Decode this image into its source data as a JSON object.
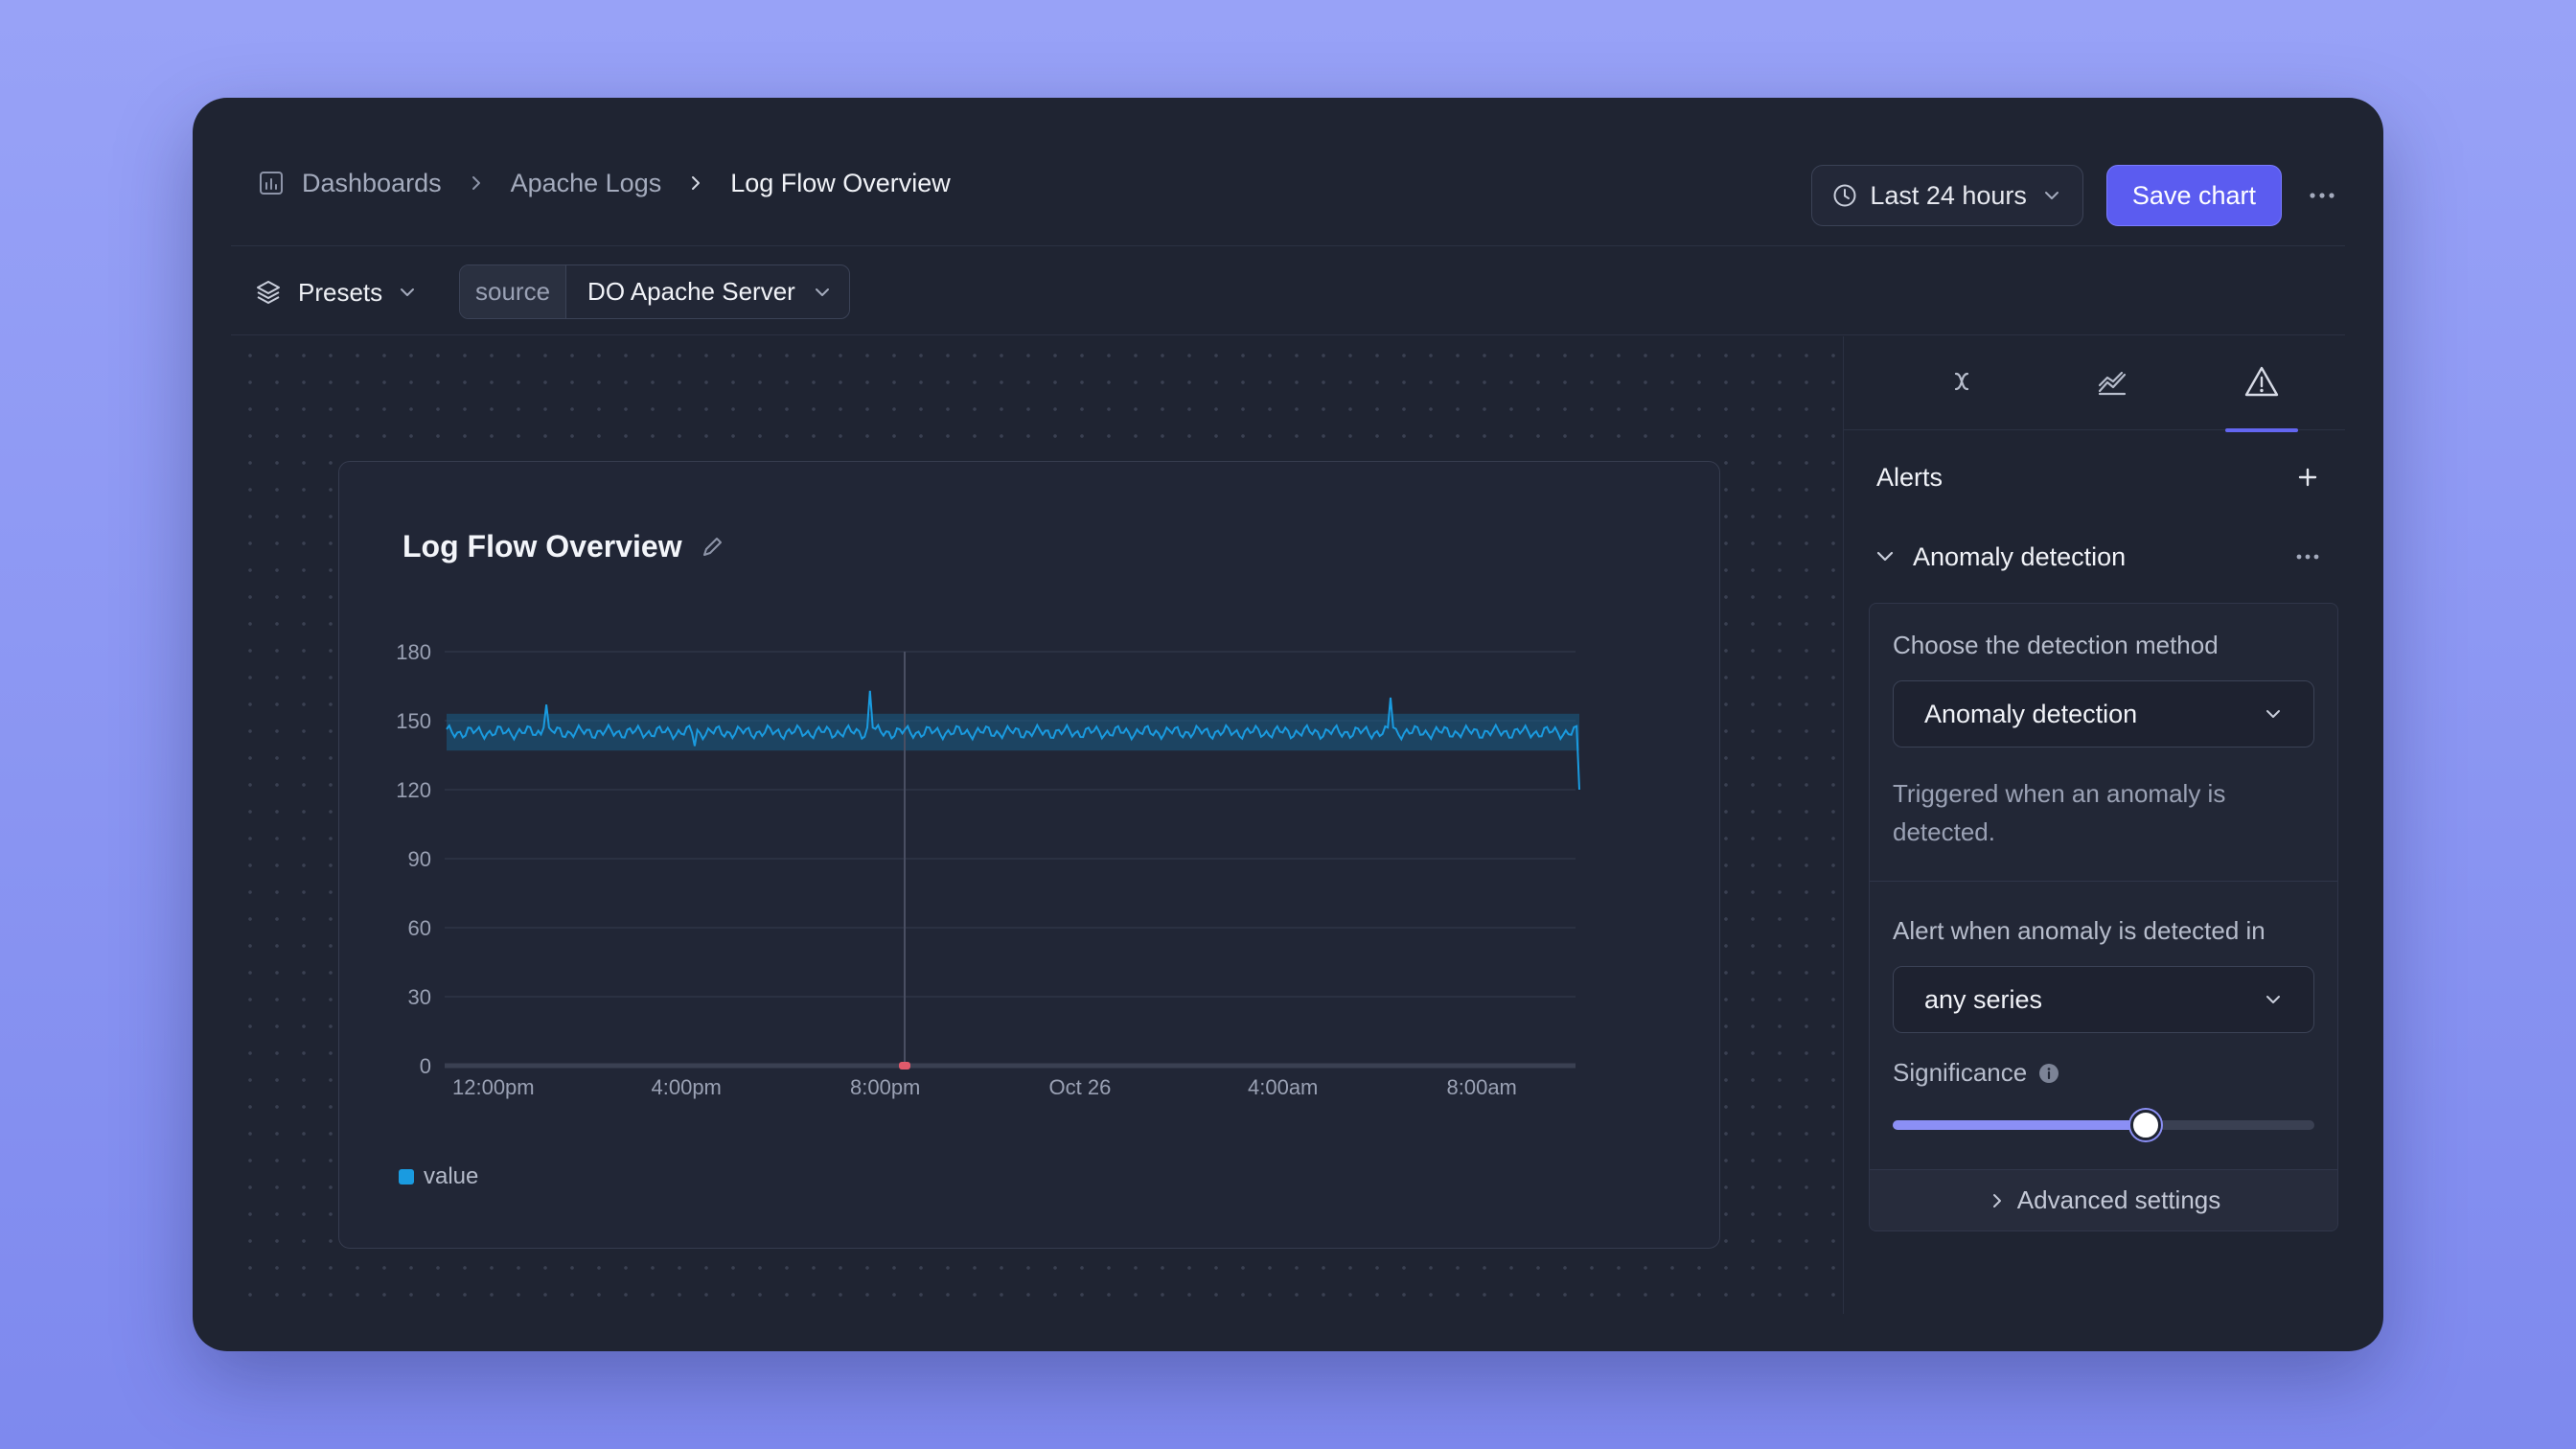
{
  "breadcrumb": {
    "items": [
      {
        "label": "Dashboards",
        "icon": "chart-icon"
      },
      {
        "label": "Apache Logs"
      },
      {
        "label": "Log Flow Overview"
      }
    ]
  },
  "header": {
    "time_range": "Last 24 hours",
    "save_label": "Save chart"
  },
  "toolbar": {
    "presets_label": "Presets",
    "filter_key": "source",
    "filter_value": "DO Apache Server"
  },
  "chart_data": {
    "type": "line",
    "title": "Log Flow Overview",
    "xlabel": "",
    "ylabel": "",
    "y_ticks": [
      "180",
      "150",
      "120",
      "90",
      "60",
      "30",
      "0"
    ],
    "x_ticks": [
      "12:00pm",
      "4:00pm",
      "8:00pm",
      "Oct 26",
      "4:00am",
      "8:00am"
    ],
    "ylim": [
      0,
      180
    ],
    "series": [
      {
        "name": "value",
        "color": "#1a9be0",
        "baseline": 145,
        "band": [
          137,
          153
        ],
        "spikes": [
          157,
          163,
          160
        ],
        "end_value": 120
      }
    ],
    "legend": [
      "value"
    ],
    "grid": true
  },
  "panel": {
    "tabs": [
      "formula-icon",
      "chart-area-icon",
      "alert-triangle-icon"
    ],
    "active_tab": 2,
    "section_title": "Alerts",
    "alert_name": "Anomaly detection",
    "method_label": "Choose the detection method",
    "method_value": "Anomaly detection",
    "method_help": "Triggered when an anomaly is detected.",
    "series_label": "Alert when anomaly is detected in",
    "series_value": "any series",
    "significance_label": "Significance",
    "significance_value": 0.6,
    "advanced_label": "Advanced settings"
  },
  "colors": {
    "accent": "#5b5cf0",
    "series": "#1a9be0",
    "marker": "#e05a6b",
    "background": "#1f2432"
  }
}
